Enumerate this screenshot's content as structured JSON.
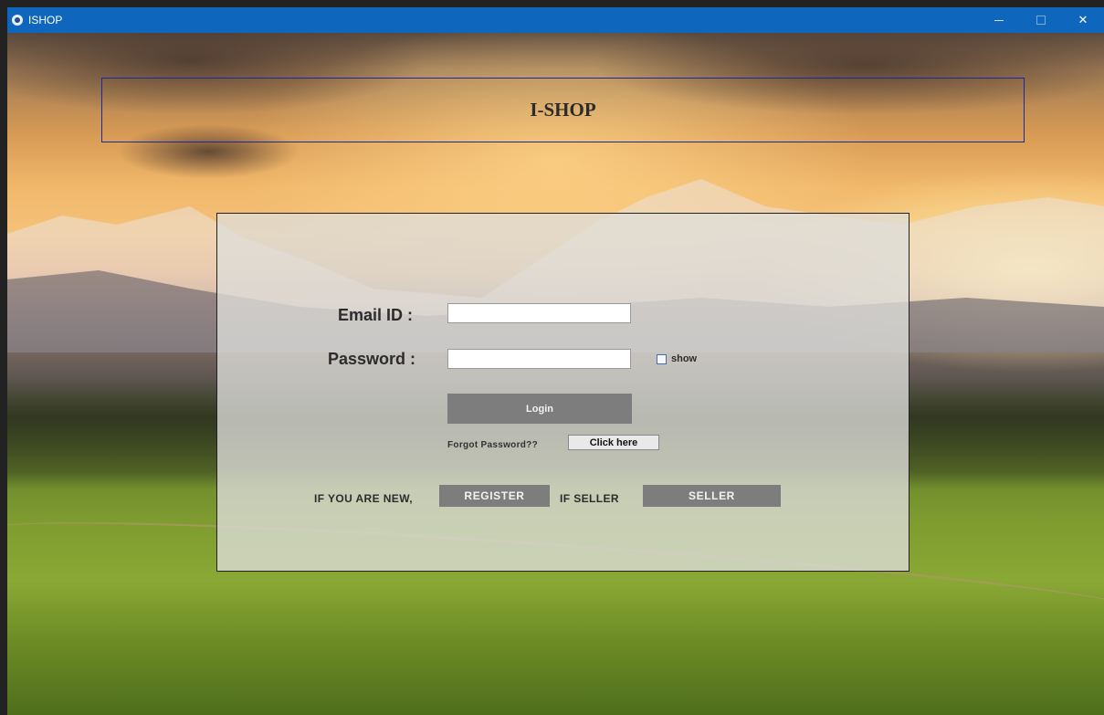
{
  "window": {
    "title": "ISHOP",
    "controls": {
      "minimize": "—",
      "maximize": "□",
      "close": "✕"
    }
  },
  "header": {
    "title": "I-SHOP"
  },
  "login": {
    "email_label": "Email ID :",
    "email_value": "",
    "password_label": "Password :",
    "password_value": "",
    "show_label": "show",
    "show_checked": false,
    "login_button": "Login",
    "forgot_text": "Forgot Password??",
    "click_here_button": "Click here"
  },
  "footer": {
    "new_text": "IF YOU ARE NEW,",
    "register_button": "REGISTER",
    "seller_text": "IF SELLER",
    "seller_button": "SELLER"
  },
  "colors": {
    "titlebar": "#0f66bd",
    "header_border": "#1a2a9a",
    "button_gray": "#7d7d7d"
  }
}
